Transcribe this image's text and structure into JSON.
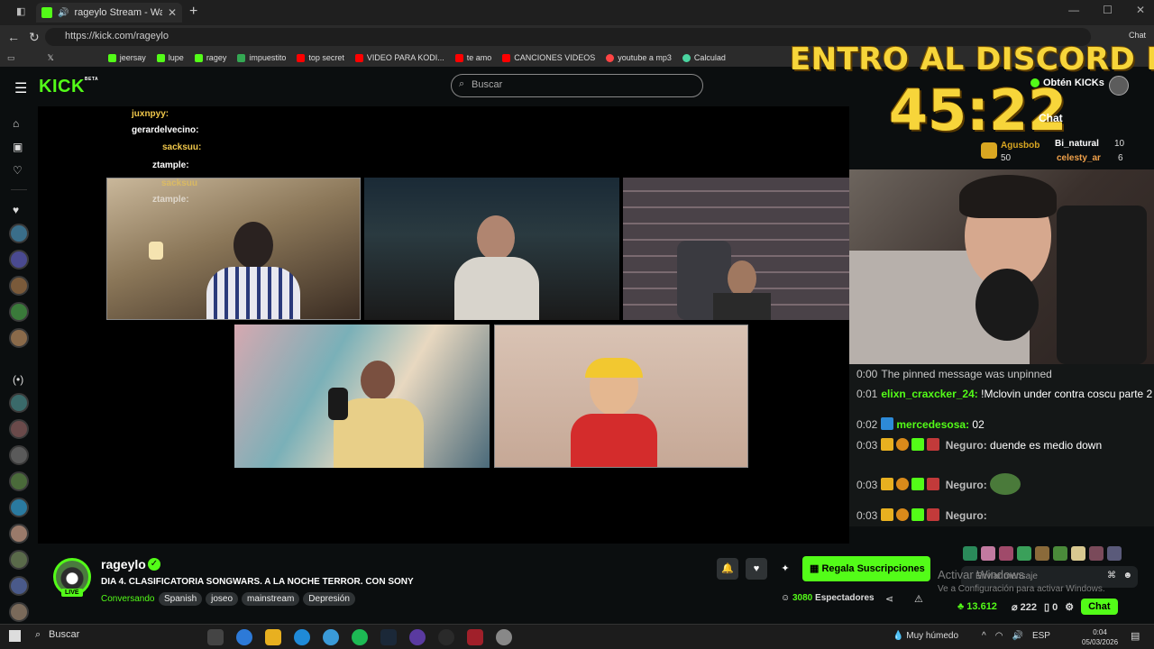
{
  "browser": {
    "tab_title": "rageylo Stream - Watch Live o",
    "url": "https://kick.com/rageylo",
    "bookmarks": [
      "jeersay",
      "lupe",
      "ragey",
      "impuestito",
      "top secret",
      "VIDEO PARA KODI...",
      "te amo",
      "CANCIONES VIDEOS",
      "youtube a mp3",
      "Calculad"
    ],
    "profile_label": "Chat"
  },
  "overlay": {
    "line1": "ENTRO AL DISCORD EN",
    "timer": "45:22"
  },
  "kick": {
    "search_placeholder": "Buscar",
    "kicks_label": "Obtén KICKs",
    "chat_title": "Chat"
  },
  "top_gifters": [
    {
      "name": "Agusbob",
      "amount": "50"
    },
    {
      "name": "Bi_natural",
      "amount": "10"
    },
    {
      "name": "celesty_ar",
      "amount": "6"
    }
  ],
  "video_chat": [
    {
      "user": "juxnpyy:"
    },
    {
      "user": "gerardelvecino:"
    },
    {
      "user": "sacksuu:"
    },
    {
      "user": "ztample:"
    },
    {
      "user": "sacksuu"
    },
    {
      "user": "ztample:"
    }
  ],
  "chat_messages": [
    {
      "time": "0:00",
      "user": "",
      "text": "The pinned message was unpinned",
      "color": "#c9c9c9"
    },
    {
      "time": "0:01",
      "user": "elixn_craxcker_24:",
      "text": "!Mclovin under contra coscu parte 2",
      "color": "#53fc18"
    },
    {
      "time": "0:02",
      "user": "mercedesosa:",
      "text": "02",
      "color": "#53fc18"
    },
    {
      "time": "0:03",
      "user": "Negurо:",
      "text": "duende es medio down",
      "color": "#bbbbbb"
    },
    {
      "time": "0:03",
      "user": "Negurо:",
      "text": "",
      "color": "#bbbbbb"
    },
    {
      "time": "0:03",
      "user": "Negurо:",
      "text": "",
      "color": "#bbbbbb"
    }
  ],
  "chat_input_placeholder": "Enviar mensaje",
  "windows_watermark": {
    "line1": "Activar Windows",
    "line2": "Ve a Configuración para activar Windows."
  },
  "chat_footer": {
    "kicks": "13.612",
    "points": "222",
    "count": "0",
    "chat_button": "Chat"
  },
  "channel": {
    "name": "rageylo",
    "live": "LIVE",
    "title": "DIA 4. CLASIFICATORIA SONGWARS. A LA NOCHE TERROR. CON SONY",
    "category": "Conversando",
    "tags": [
      "Spanish",
      "joseo",
      "mainstream",
      "Depresión"
    ],
    "subscribe_label": "Regala Suscripciones",
    "viewers": "3080",
    "viewers_label": "Espectadores"
  },
  "taskbar": {
    "search": "Buscar",
    "weather": "Muy húmedo",
    "lang": "ESP",
    "time": "0:04",
    "date": "05/03/2026"
  }
}
